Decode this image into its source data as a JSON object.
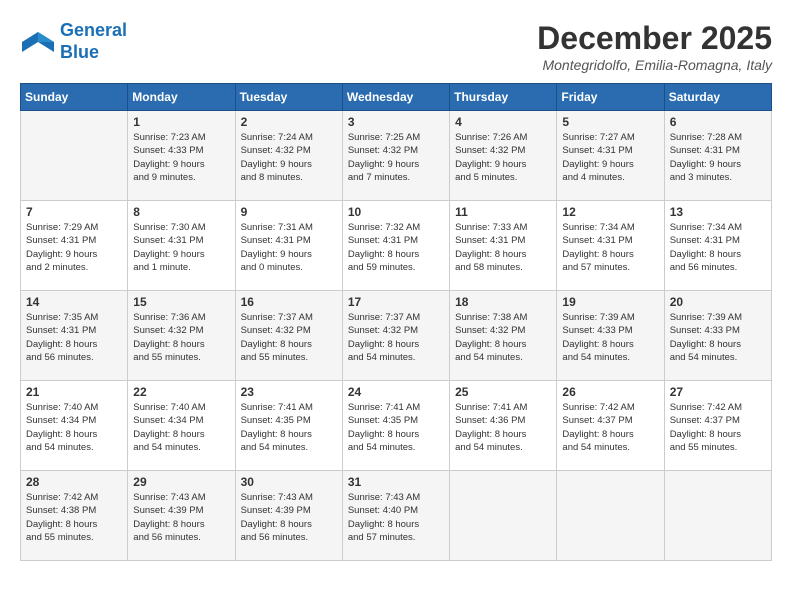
{
  "header": {
    "logo_line1": "General",
    "logo_line2": "Blue",
    "month_title": "December 2025",
    "location": "Montegridolfo, Emilia-Romagna, Italy"
  },
  "days_of_week": [
    "Sunday",
    "Monday",
    "Tuesday",
    "Wednesday",
    "Thursday",
    "Friday",
    "Saturday"
  ],
  "weeks": [
    [
      {
        "day": "",
        "info": ""
      },
      {
        "day": "1",
        "info": "Sunrise: 7:23 AM\nSunset: 4:33 PM\nDaylight: 9 hours\nand 9 minutes."
      },
      {
        "day": "2",
        "info": "Sunrise: 7:24 AM\nSunset: 4:32 PM\nDaylight: 9 hours\nand 8 minutes."
      },
      {
        "day": "3",
        "info": "Sunrise: 7:25 AM\nSunset: 4:32 PM\nDaylight: 9 hours\nand 7 minutes."
      },
      {
        "day": "4",
        "info": "Sunrise: 7:26 AM\nSunset: 4:32 PM\nDaylight: 9 hours\nand 5 minutes."
      },
      {
        "day": "5",
        "info": "Sunrise: 7:27 AM\nSunset: 4:31 PM\nDaylight: 9 hours\nand 4 minutes."
      },
      {
        "day": "6",
        "info": "Sunrise: 7:28 AM\nSunset: 4:31 PM\nDaylight: 9 hours\nand 3 minutes."
      }
    ],
    [
      {
        "day": "7",
        "info": "Sunrise: 7:29 AM\nSunset: 4:31 PM\nDaylight: 9 hours\nand 2 minutes."
      },
      {
        "day": "8",
        "info": "Sunrise: 7:30 AM\nSunset: 4:31 PM\nDaylight: 9 hours\nand 1 minute."
      },
      {
        "day": "9",
        "info": "Sunrise: 7:31 AM\nSunset: 4:31 PM\nDaylight: 9 hours\nand 0 minutes."
      },
      {
        "day": "10",
        "info": "Sunrise: 7:32 AM\nSunset: 4:31 PM\nDaylight: 8 hours\nand 59 minutes."
      },
      {
        "day": "11",
        "info": "Sunrise: 7:33 AM\nSunset: 4:31 PM\nDaylight: 8 hours\nand 58 minutes."
      },
      {
        "day": "12",
        "info": "Sunrise: 7:34 AM\nSunset: 4:31 PM\nDaylight: 8 hours\nand 57 minutes."
      },
      {
        "day": "13",
        "info": "Sunrise: 7:34 AM\nSunset: 4:31 PM\nDaylight: 8 hours\nand 56 minutes."
      }
    ],
    [
      {
        "day": "14",
        "info": "Sunrise: 7:35 AM\nSunset: 4:31 PM\nDaylight: 8 hours\nand 56 minutes."
      },
      {
        "day": "15",
        "info": "Sunrise: 7:36 AM\nSunset: 4:32 PM\nDaylight: 8 hours\nand 55 minutes."
      },
      {
        "day": "16",
        "info": "Sunrise: 7:37 AM\nSunset: 4:32 PM\nDaylight: 8 hours\nand 55 minutes."
      },
      {
        "day": "17",
        "info": "Sunrise: 7:37 AM\nSunset: 4:32 PM\nDaylight: 8 hours\nand 54 minutes."
      },
      {
        "day": "18",
        "info": "Sunrise: 7:38 AM\nSunset: 4:32 PM\nDaylight: 8 hours\nand 54 minutes."
      },
      {
        "day": "19",
        "info": "Sunrise: 7:39 AM\nSunset: 4:33 PM\nDaylight: 8 hours\nand 54 minutes."
      },
      {
        "day": "20",
        "info": "Sunrise: 7:39 AM\nSunset: 4:33 PM\nDaylight: 8 hours\nand 54 minutes."
      }
    ],
    [
      {
        "day": "21",
        "info": "Sunrise: 7:40 AM\nSunset: 4:34 PM\nDaylight: 8 hours\nand 54 minutes."
      },
      {
        "day": "22",
        "info": "Sunrise: 7:40 AM\nSunset: 4:34 PM\nDaylight: 8 hours\nand 54 minutes."
      },
      {
        "day": "23",
        "info": "Sunrise: 7:41 AM\nSunset: 4:35 PM\nDaylight: 8 hours\nand 54 minutes."
      },
      {
        "day": "24",
        "info": "Sunrise: 7:41 AM\nSunset: 4:35 PM\nDaylight: 8 hours\nand 54 minutes."
      },
      {
        "day": "25",
        "info": "Sunrise: 7:41 AM\nSunset: 4:36 PM\nDaylight: 8 hours\nand 54 minutes."
      },
      {
        "day": "26",
        "info": "Sunrise: 7:42 AM\nSunset: 4:37 PM\nDaylight: 8 hours\nand 54 minutes."
      },
      {
        "day": "27",
        "info": "Sunrise: 7:42 AM\nSunset: 4:37 PM\nDaylight: 8 hours\nand 55 minutes."
      }
    ],
    [
      {
        "day": "28",
        "info": "Sunrise: 7:42 AM\nSunset: 4:38 PM\nDaylight: 8 hours\nand 55 minutes."
      },
      {
        "day": "29",
        "info": "Sunrise: 7:43 AM\nSunset: 4:39 PM\nDaylight: 8 hours\nand 56 minutes."
      },
      {
        "day": "30",
        "info": "Sunrise: 7:43 AM\nSunset: 4:39 PM\nDaylight: 8 hours\nand 56 minutes."
      },
      {
        "day": "31",
        "info": "Sunrise: 7:43 AM\nSunset: 4:40 PM\nDaylight: 8 hours\nand 57 minutes."
      },
      {
        "day": "",
        "info": ""
      },
      {
        "day": "",
        "info": ""
      },
      {
        "day": "",
        "info": ""
      }
    ]
  ]
}
